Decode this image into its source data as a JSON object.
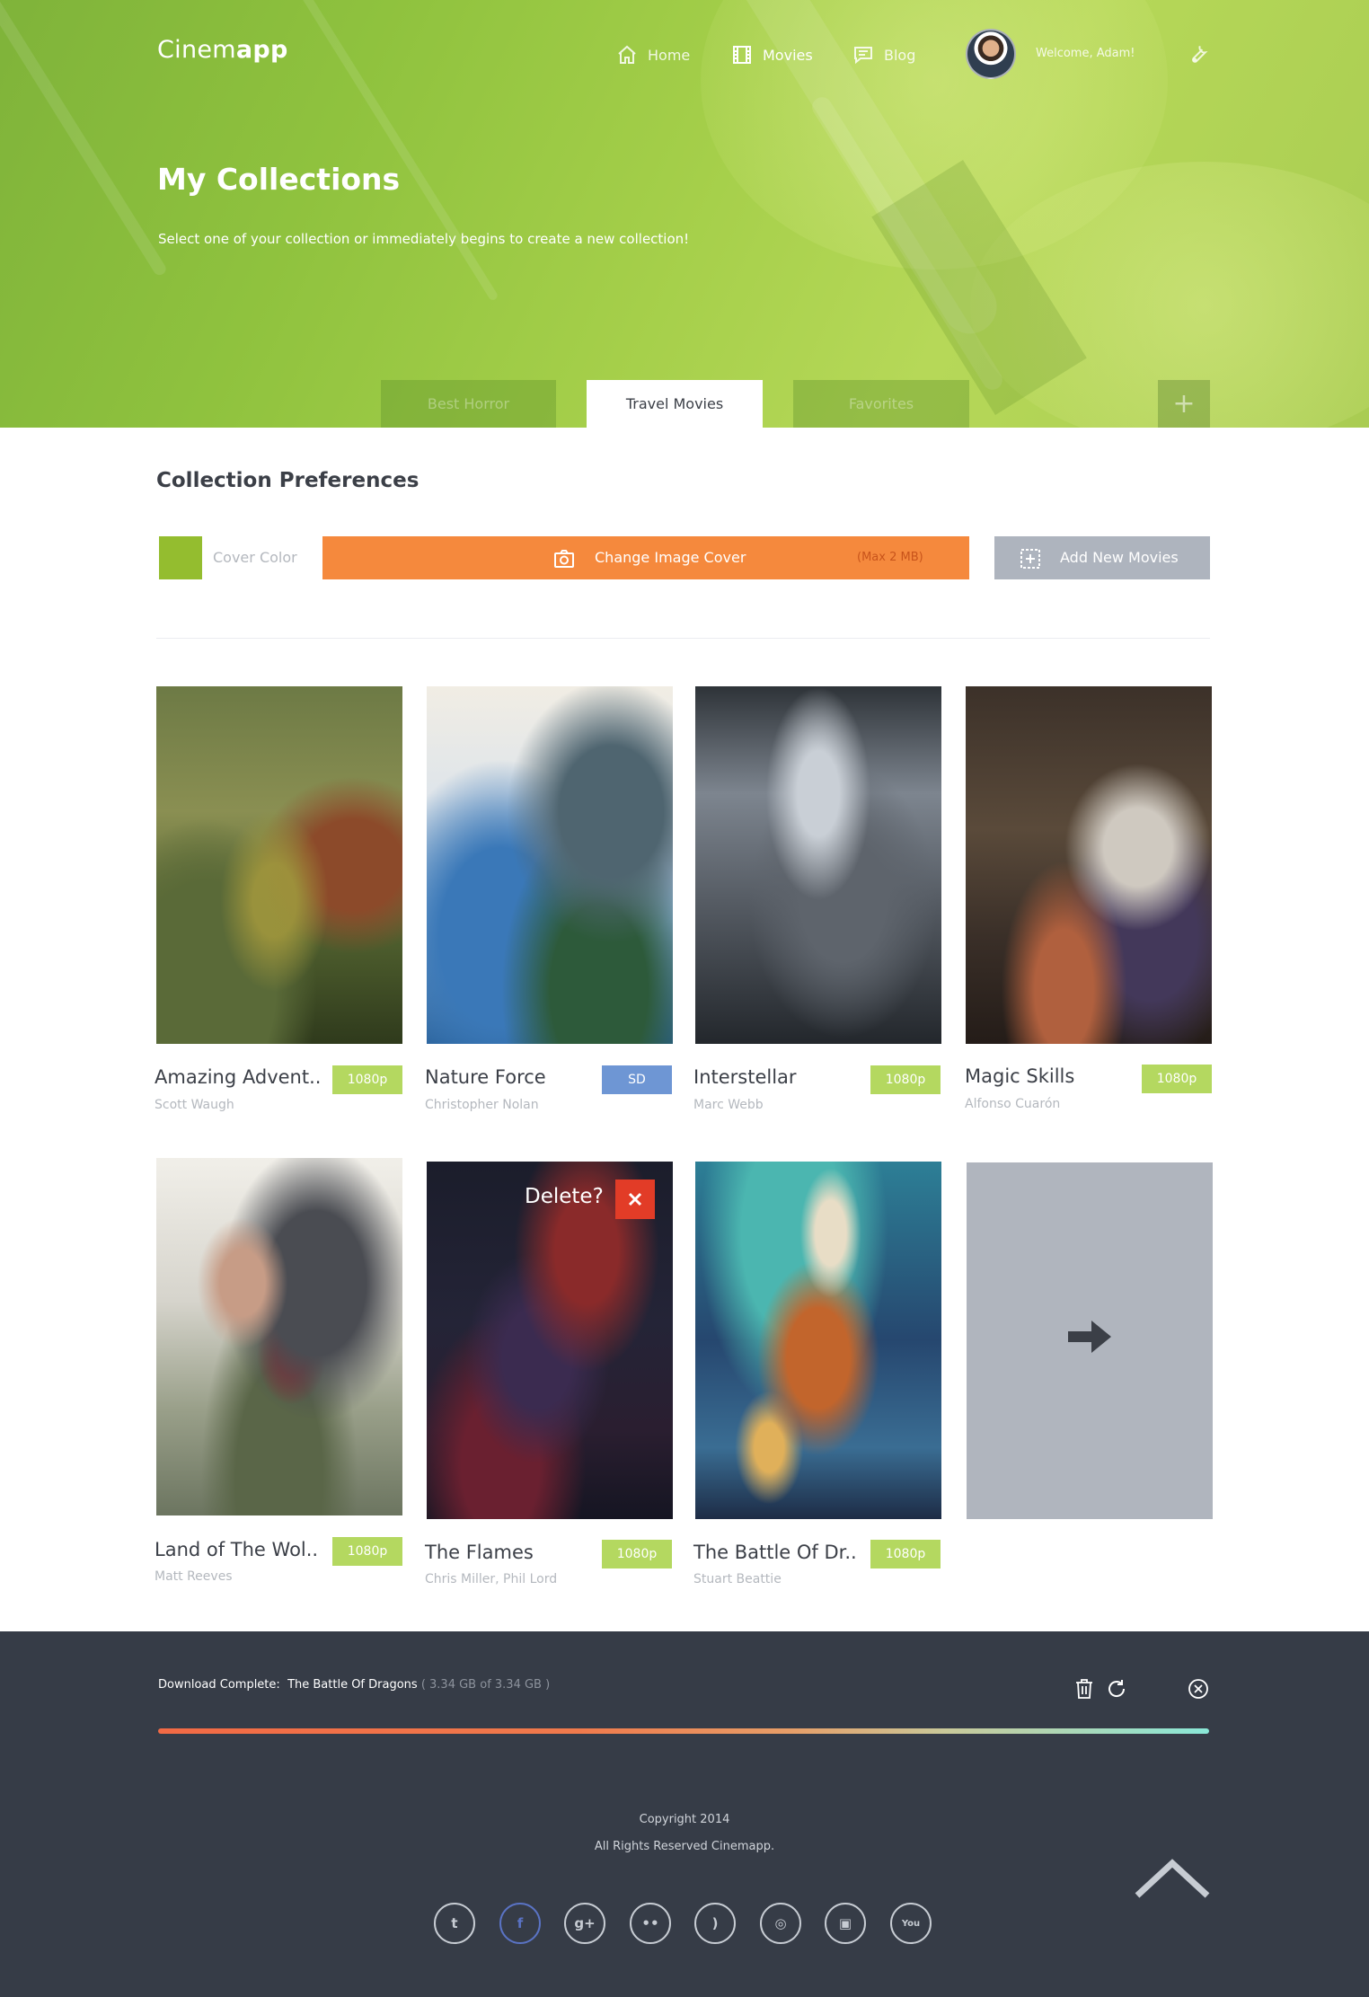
{
  "app": {
    "logo_regular": "Cinem",
    "logo_bold": "app"
  },
  "nav": {
    "home": "Home",
    "movies": "Movies",
    "blog": "Blog"
  },
  "user": {
    "welcome": "Welcome, Adam!"
  },
  "hero": {
    "title": "My Collections",
    "subtitle": "Select one of your collection or immediately begins to create a new collection!"
  },
  "tabs": [
    {
      "label": "Best Horror",
      "active": false
    },
    {
      "label": "Travel Movies",
      "active": true
    },
    {
      "label": "Favorites",
      "active": false
    }
  ],
  "tab_add_label": "+",
  "preferences": {
    "title": "Collection Preferences",
    "cover_color_label": "Cover Color",
    "cover_color": "#94bd2f",
    "change_cover_label": "Change Image Cover",
    "change_cover_note": "(Max 2 MB)",
    "add_movies_label": "Add New Movies"
  },
  "movies": [
    {
      "title": "Amazing Advent..",
      "director": "Scott Waugh",
      "quality": "1080p"
    },
    {
      "title": "Nature Force",
      "director": "Christopher Nolan",
      "quality": "SD"
    },
    {
      "title": "Interstellar",
      "director": "Marc Webb",
      "quality": "1080p"
    },
    {
      "title": "Magic Skills",
      "director": "Alfonso Cuarón",
      "quality": "1080p"
    },
    {
      "title": "Land of The Wol..",
      "director": "Matt Reeves",
      "quality": "1080p"
    },
    {
      "title": "The Flames",
      "director": "Chris Miller, Phil Lord",
      "quality": "1080p"
    },
    {
      "title": "The Battle Of Dr..",
      "director": "Stuart Beattie",
      "quality": "1080p"
    }
  ],
  "delete_prompt": "Delete?",
  "download": {
    "label": "Download Complete:",
    "name": "The Battle Of Dragons",
    "size": "( 3.34 GB   of   3.34 GB )",
    "progress": 1.0
  },
  "footer": {
    "copyright": "Copyright 2014",
    "rights": "All Rights Reserved Cinemapp."
  },
  "social": [
    {
      "name": "twitter-icon",
      "glyph": "t",
      "active": false
    },
    {
      "name": "facebook-icon",
      "glyph": "f",
      "active": true
    },
    {
      "name": "google-plus-icon",
      "glyph": "g+",
      "active": false
    },
    {
      "name": "flickr-icon",
      "glyph": "••",
      "active": false
    },
    {
      "name": "rss-icon",
      "glyph": ")",
      "active": false
    },
    {
      "name": "dribbble-icon",
      "glyph": "◎",
      "active": false
    },
    {
      "name": "instagram-icon",
      "glyph": "▣",
      "active": false
    },
    {
      "name": "youtube-icon",
      "glyph": "You",
      "active": false
    }
  ],
  "colors": {
    "accent_green": "#b4d860",
    "accent_orange": "#f5893d",
    "delete_red": "#e23c27",
    "footer_bg": "#363c47"
  }
}
